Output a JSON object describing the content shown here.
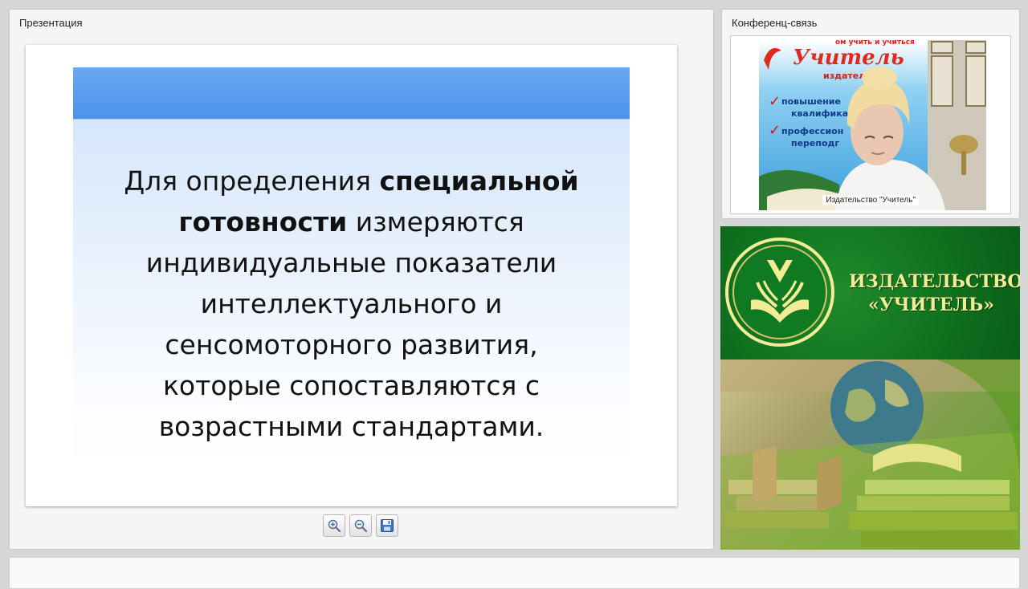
{
  "presentation": {
    "title": "Презентация",
    "slide": {
      "line1_plain": "Для определения ",
      "line1_bold": "специальной",
      "line2_bold": "готовности",
      "line2_plain": " измеряются",
      "line3": "индивидуальные показатели",
      "line4": "интеллектуального и",
      "line5": "сенсомоторного развития,",
      "line6": "которые сопоставляются с",
      "line7": "возрастными стандартами."
    },
    "toolbar": {
      "zoom_in_icon": "zoom-in-icon",
      "zoom_out_icon": "zoom-out-icon",
      "save_icon": "floppy-disk-icon"
    }
  },
  "conference": {
    "title": "Конференц-связь",
    "video": {
      "caption": "Издательство \"Учитель\"",
      "poster_line1": "Учитель",
      "poster_line2": "издательство",
      "poster_item1": "повышение",
      "poster_item2": "квалификац",
      "poster_item3": "профессион",
      "poster_item4": "переподг",
      "poster_top": "ом учить и учиться"
    }
  },
  "banner": {
    "line1": "ИЗДАТЕЛЬСТВО",
    "line2": "«УЧИТЕЛЬ»"
  },
  "colors": {
    "banner_green": "#0c6b1c",
    "banner_text": "#f3ec96",
    "slide_header": "#4d92ec"
  }
}
